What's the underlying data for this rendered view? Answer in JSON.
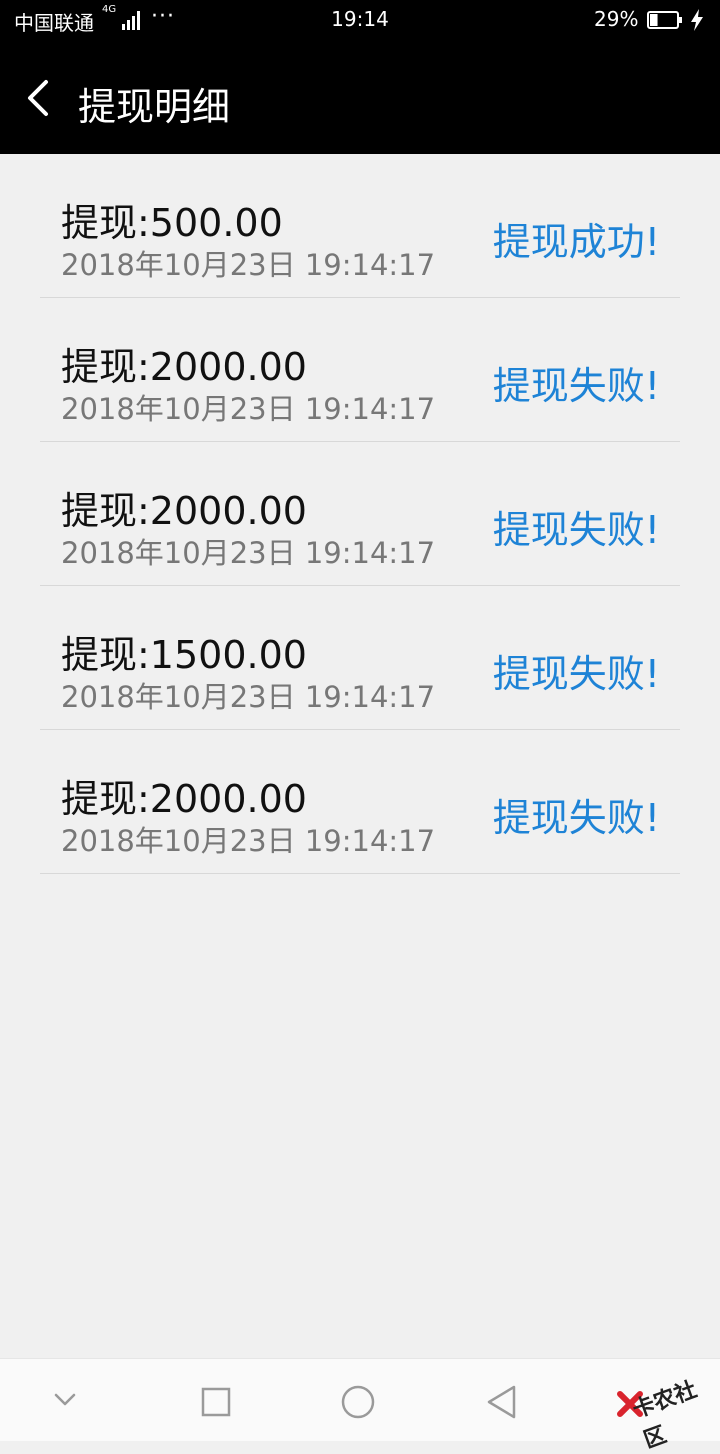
{
  "status_bar": {
    "carrier": "中国联通",
    "network": "4G",
    "dots": "···",
    "time": "19:14",
    "battery": "29%",
    "battery_level": 0.29
  },
  "header": {
    "title": "提现明细"
  },
  "records": [
    {
      "amount": "提现:500.00",
      "date": "2018年10月23日 19:14:17",
      "status": "提现成功!"
    },
    {
      "amount": "提现:2000.00",
      "date": "2018年10月23日 19:14:17",
      "status": "提现失败!"
    },
    {
      "amount": "提现:2000.00",
      "date": "2018年10月23日 19:14:17",
      "status": "提现失败!"
    },
    {
      "amount": "提现:1500.00",
      "date": "2018年10月23日 19:14:17",
      "status": "提现失败!"
    },
    {
      "amount": "提现:2000.00",
      "date": "2018年10月23日 19:14:17",
      "status": "提现失败!"
    }
  ],
  "watermark": {
    "text": "卡农社区"
  },
  "colors": {
    "header_bg": "#000000",
    "page_bg": "#f0f0f0",
    "status_blue": "#1e83d6"
  }
}
